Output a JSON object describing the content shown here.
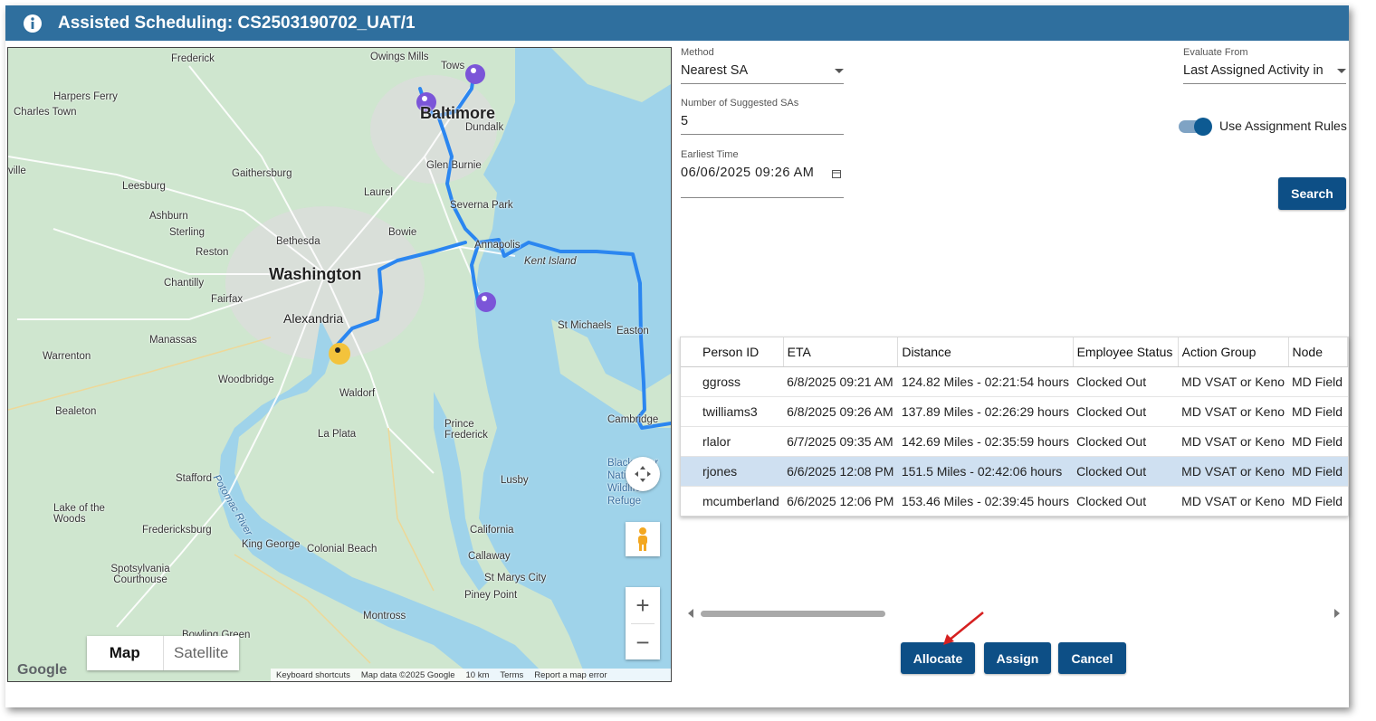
{
  "dialog": {
    "title": "Assisted Scheduling: CS2503190702_UAT/1",
    "icon": "info-icon"
  },
  "map": {
    "labels": {
      "washington": "Washington",
      "baltimore": "Baltimore",
      "alexandria": "Alexandria",
      "annapolis": "Annapolis",
      "frederick": "Frederick",
      "owings_mills": "Owings Mills",
      "towson": "Tows",
      "harpers_ferry": "Harpers Ferry",
      "charles_town": "Charles Town",
      "ville": "ville",
      "gaithersburg": "Gaithersburg",
      "leesburg": "Leesburg",
      "ashburn": "Ashburn",
      "sterling": "Sterling",
      "reston": "Reston",
      "bethesda": "Bethesda",
      "laurel": "Laurel",
      "bowie": "Bowie",
      "dundalk": "Dundalk",
      "glen_burnie": "Glen Burnie",
      "severna_park": "Severna Park",
      "kent_island": "Kent Island",
      "chantilly": "Chantilly",
      "fairfax": "Fairfax",
      "manassas": "Manassas",
      "warrenton": "Warrenton",
      "woodbridge": "Woodbridge",
      "waldorf": "Waldorf",
      "st_michaels": "St Michaels",
      "easton": "Easton",
      "bealeton": "Bealeton",
      "la_plata": "La Plata",
      "prince_frederick": "Prince Frederick",
      "cambridge": "Cambridge",
      "stafford": "Stafford",
      "potomac_river": "Potomac River",
      "lusby": "Lusby",
      "lake_of_the_woods": "Lake of the Woods",
      "fredericksburg": "Fredericksburg",
      "king_george": "King George",
      "colonial_beach": "Colonial Beach",
      "california": "California",
      "callaway": "Callaway",
      "spotsylvania": "Spotsylvania Courthouse",
      "st_marys_city": "St Marys City",
      "piney_point": "Piney Point",
      "montross": "Montross",
      "bowling_green": "Bowling Green",
      "blackwater": "Blackwater National Wildlife Refuge"
    },
    "type_control": {
      "map": "Map",
      "satellite": "Satellite"
    },
    "footer": {
      "shortcuts": "Keyboard shortcuts",
      "map_data": "Map data ©2025 Google",
      "scale": "10 km",
      "terms": "Terms",
      "report": "Report a map error"
    },
    "logo": "Google",
    "zoom_in": "+",
    "zoom_out": "−"
  },
  "form": {
    "method_label": "Method",
    "method_value": "Nearest SA",
    "evaluate_label": "Evaluate From",
    "evaluate_value": "Last Assigned Activity in",
    "num_label": "Number of Suggested SAs",
    "num_value": "5",
    "assignment_rules_label": "Use Assignment Rules",
    "assignment_rules_on": true,
    "earliest_label": "Earliest Time",
    "earliest_value": "06/06/2025 09:26 AM",
    "search_label": "Search"
  },
  "table": {
    "columns": [
      "Person ID",
      "ETA",
      "Distance",
      "Employee Status",
      "Action Group",
      "Node"
    ],
    "rows": [
      [
        "ggross",
        "6/8/2025 09:21 AM",
        "124.82 Miles - 02:21:54 hours",
        "Clocked Out",
        "MD VSAT or Keno",
        "MD Field"
      ],
      [
        "twilliams3",
        "6/8/2025 09:26 AM",
        "137.89 Miles - 02:26:29 hours",
        "Clocked Out",
        "MD VSAT or Keno",
        "MD Field"
      ],
      [
        "rlalor",
        "6/7/2025 09:35 AM",
        "142.69 Miles - 02:35:59 hours",
        "Clocked Out",
        "MD VSAT or Keno",
        "MD Field"
      ],
      [
        "rjones",
        "6/6/2025 12:08 PM",
        "151.5 Miles - 02:42:06 hours",
        "Clocked Out",
        "MD VSAT or Keno",
        "MD Field"
      ],
      [
        "mcumberland",
        "6/6/2025 12:06 PM",
        "153.46 Miles - 02:39:45 hours",
        "Clocked Out",
        "MD VSAT or Keno",
        "MD Field"
      ]
    ],
    "selected_row": 3
  },
  "actions": {
    "allocate": "Allocate",
    "assign": "Assign",
    "cancel": "Cancel"
  },
  "colors": {
    "title_bar": "#2f6f9e",
    "button": "#0d4f86",
    "route": "#2b86f0",
    "water": "#9fd3ea",
    "land": "#cfe6cf",
    "marker_purple": "#7b55d8",
    "marker_yellow": "#f3c33c",
    "annotation_arrow": "#d62020",
    "selected_row": "#cfe0f1"
  }
}
